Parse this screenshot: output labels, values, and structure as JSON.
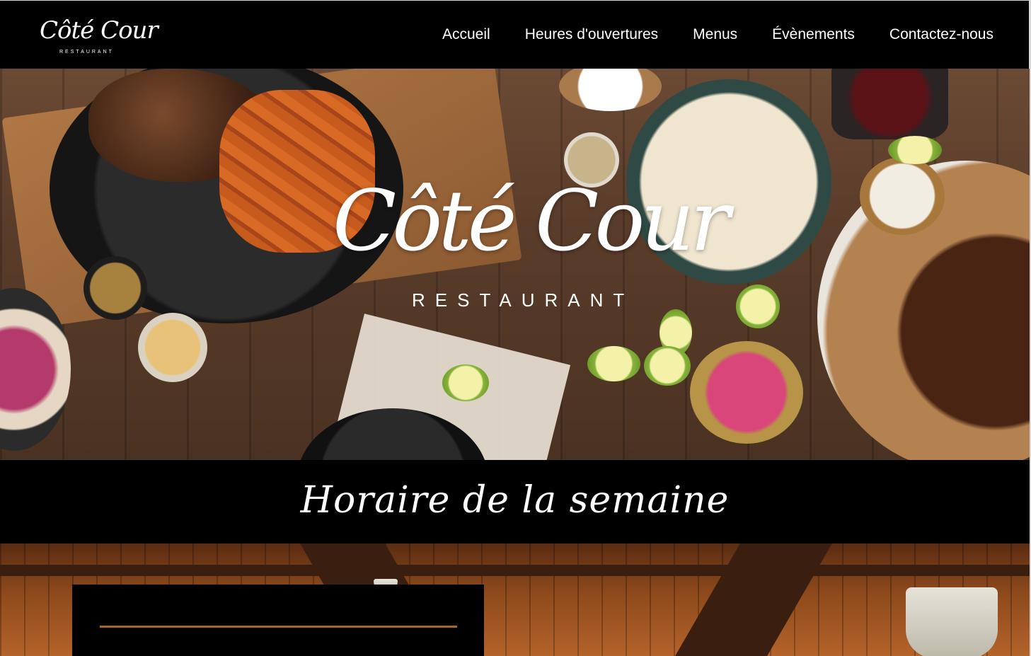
{
  "header": {
    "logo": {
      "script": "Côté Cour",
      "sub": "RESTAURANT"
    },
    "nav": [
      {
        "label": "Accueil"
      },
      {
        "label": "Heures d'ouvertures"
      },
      {
        "label": "Menus"
      },
      {
        "label": "Évènements"
      },
      {
        "label": "Contactez-nous"
      }
    ]
  },
  "hero": {
    "title": "Côté Cour",
    "subtitle": "RESTAURANT"
  },
  "section": {
    "title": "Horaire de la semaine"
  },
  "colors": {
    "background": "#000000",
    "accent_rule": "#a0672e",
    "text": "#ffffff"
  }
}
